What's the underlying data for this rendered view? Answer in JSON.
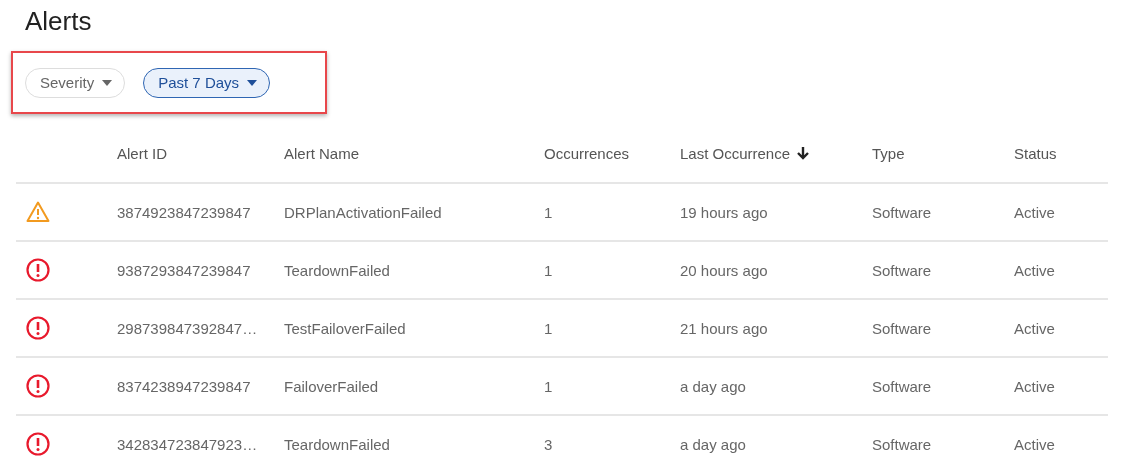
{
  "title": "Alerts",
  "filters": [
    {
      "label": "Severity",
      "active": false
    },
    {
      "label": "Past 7 Days",
      "active": true
    }
  ],
  "table": {
    "columns": [
      {
        "label": "Alert ID",
        "sorted": false
      },
      {
        "label": "Alert Name",
        "sorted": false
      },
      {
        "label": "Occurrences",
        "sorted": false
      },
      {
        "label": "Last Occurrence",
        "sorted": true
      },
      {
        "label": "Type",
        "sorted": false
      },
      {
        "label": "Status",
        "sorted": false
      }
    ],
    "rows": [
      {
        "kind": "warning",
        "id": "3874923847239847",
        "name": "DRPlanActivationFailed",
        "occurrences": "1",
        "last": "19 hours ago",
        "type": "Software",
        "status": "Active"
      },
      {
        "kind": "error",
        "id": "9387293847239847",
        "name": "TeardownFailed",
        "occurrences": "1",
        "last": "20 hours ago",
        "type": "Software",
        "status": "Active"
      },
      {
        "kind": "error",
        "id": "298739847392847…",
        "name": "TestFailoverFailed",
        "occurrences": "1",
        "last": "21 hours ago",
        "type": "Software",
        "status": "Active"
      },
      {
        "kind": "error",
        "id": "8374238947239847",
        "name": "FailoverFailed",
        "occurrences": "1",
        "last": "a day ago",
        "type": "Software",
        "status": "Active"
      },
      {
        "kind": "error",
        "id": "342834723847923…",
        "name": "TeardownFailed",
        "occurrences": "3",
        "last": "a day ago",
        "type": "Software",
        "status": "Active"
      }
    ]
  }
}
